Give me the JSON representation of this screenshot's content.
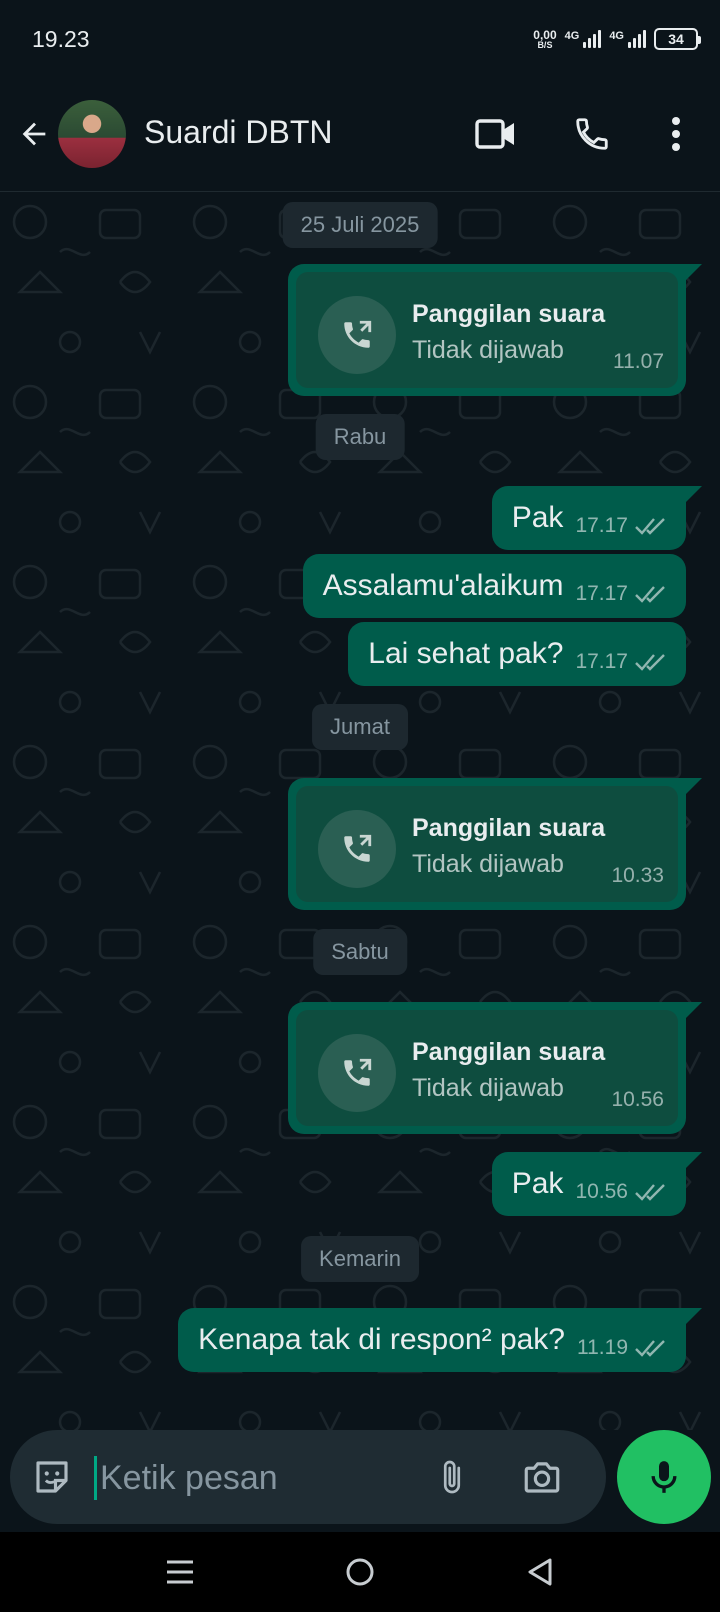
{
  "status_bar": {
    "time": "19.23",
    "net_speed_value": "0,00",
    "net_speed_unit": "B/S",
    "sim1_label": "4G",
    "sim2_label": "4G",
    "battery": "34"
  },
  "header": {
    "contact_name": "Suardi DBTN"
  },
  "chat": {
    "items": [
      {
        "type": "date",
        "label": "25 Juli 2025"
      },
      {
        "type": "call",
        "title": "Panggilan suara",
        "status": "Tidak dijawab",
        "time": "11.07"
      },
      {
        "type": "date",
        "label": "Rabu"
      },
      {
        "type": "text",
        "text": "Pak",
        "time": "17.17"
      },
      {
        "type": "text",
        "text": "Assalamu'alaikum",
        "time": "17.17"
      },
      {
        "type": "text",
        "text": "Lai sehat pak?",
        "time": "17.17"
      },
      {
        "type": "date",
        "label": "Jumat"
      },
      {
        "type": "call",
        "title": "Panggilan suara",
        "status": "Tidak dijawab",
        "time": "10.33"
      },
      {
        "type": "date",
        "label": "Sabtu"
      },
      {
        "type": "call",
        "title": "Panggilan suara",
        "status": "Tidak dijawab",
        "time": "10.56"
      },
      {
        "type": "text",
        "text": "Pak",
        "time": "10.56"
      },
      {
        "type": "date",
        "label": "Kemarin"
      },
      {
        "type": "text",
        "text": "Kenapa tak di respon² pak?",
        "time": "11.19"
      }
    ]
  },
  "input": {
    "placeholder": "Ketik pesan"
  },
  "colors": {
    "background": "#0b141a",
    "outgoing_bubble": "#005c4b",
    "accent_green": "#21c063",
    "date_chip": "#1d282f"
  },
  "icons": {
    "back": "arrow-left-icon",
    "video": "video-camera-icon",
    "voice": "phone-icon",
    "menu": "more-vertical-icon",
    "sticker": "sticker-icon",
    "attach": "paperclip-icon",
    "camera": "camera-icon",
    "mic": "microphone-icon",
    "call_missed_out": "outgoing-call-icon",
    "read_receipt": "double-check-icon"
  }
}
